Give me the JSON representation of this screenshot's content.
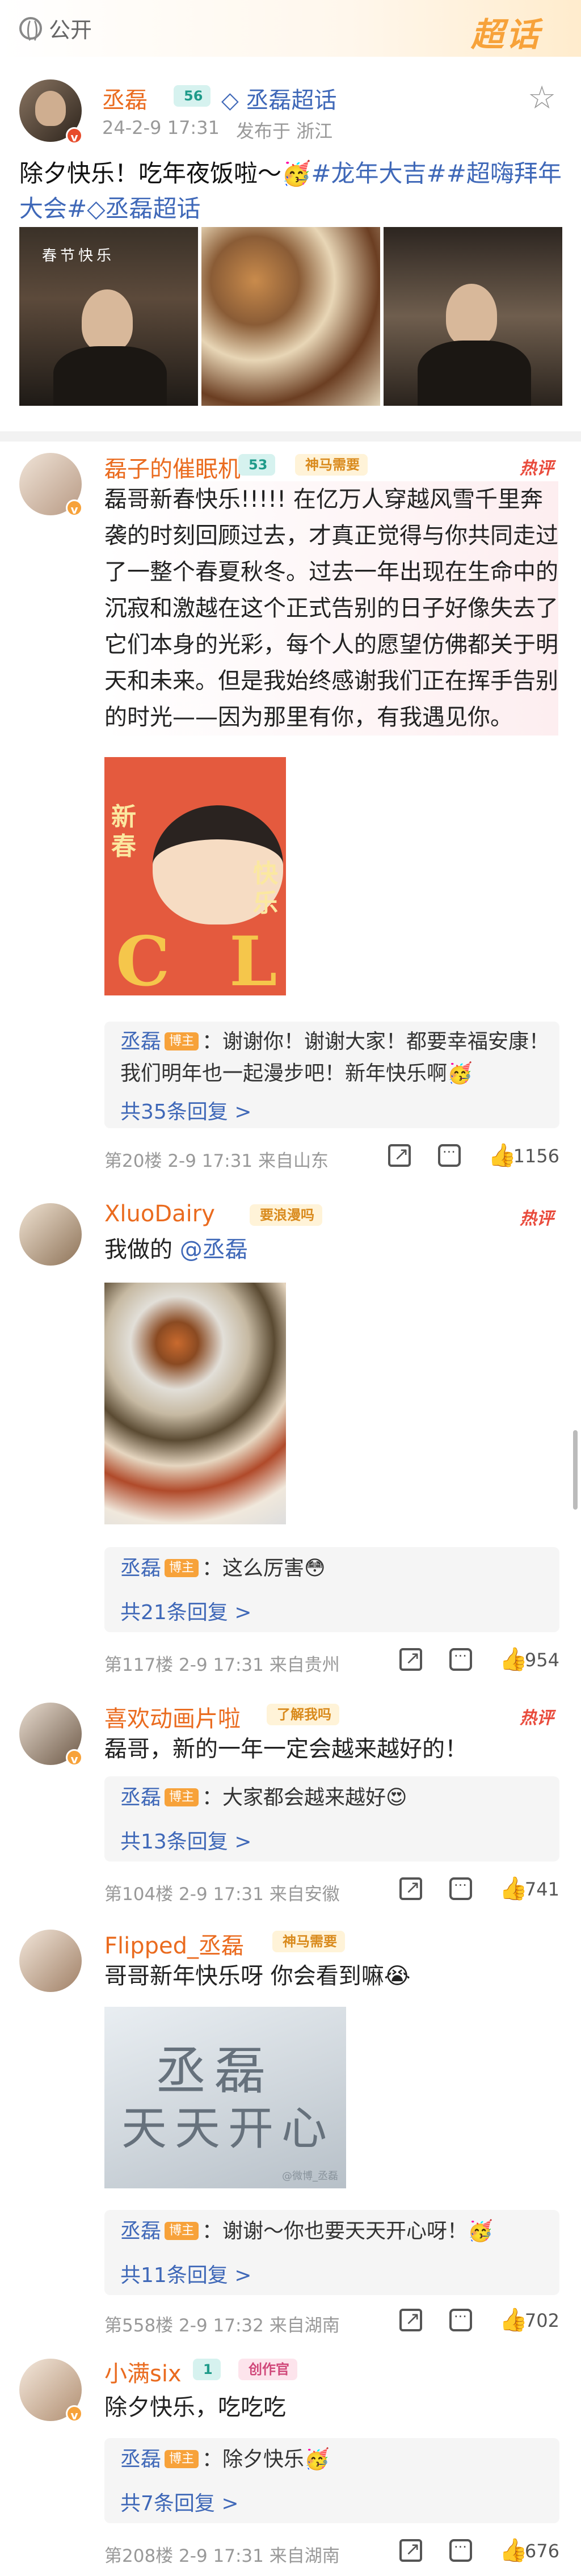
{
  "topbar": {
    "visibility": "公开",
    "logo": "超话"
  },
  "post": {
    "author": "丞磊",
    "level": "56",
    "chaohua": "丞磊超话",
    "time": "24-2-9 17:31",
    "location": "发布于 浙江",
    "text_main": "除夕快乐！吃年夜饭啦～",
    "tag1": "#龙年大吉#",
    "tag2": "#超嗨拜年大会#",
    "tag3": "丞磊超话",
    "photo_caption": "春节快乐"
  },
  "comments": [
    {
      "name": "磊子的催眠机",
      "level": "53",
      "badge": "神马需要",
      "hot": "热评",
      "text": "磊哥新春快乐!!!!! 在亿万人穿越风雪千里奔袭的时刻回顾过去，才真正觉得与你共同走过了一整个春夏秋冬。过去一年出现在生命中的沉寂和激越在这个正式告别的日子好像失去了它们本身的光彩，每个人的愿望仿佛都关于明天和未来。但是我始终感谢我们正在挥手告别的时光——因为那里有你，有我遇见你。",
      "sticker": {
        "char1": "C",
        "char2": "L",
        "side1": "新春",
        "side2": "快乐"
      },
      "reply_name": "丞磊",
      "author_tag": "博主",
      "reply_text": "：谢谢你！谢谢大家！都要幸福安康！我们明年也一起漫步吧！新年快乐啊",
      "reply_count": "共35条回复 >",
      "floor": "第20楼",
      "time": "2-9 17:31",
      "from": "来自山东",
      "likes": "1156"
    },
    {
      "name": "XluoDairy",
      "badge": "要浪漫吗",
      "hot": "热评",
      "text_prefix": "我做的 ",
      "mention": "@丞磊",
      "reply_name": "丞磊",
      "author_tag": "博主",
      "reply_text": "：这么厉害",
      "reply_count": "共21条回复 >",
      "floor": "第117楼",
      "time": "2-9 17:31",
      "from": "来自贵州",
      "likes": "954"
    },
    {
      "name": "喜欢动画片啦",
      "badge": "了解我吗",
      "hot": "热评",
      "text": "磊哥，新的一年一定会越来越好的！",
      "reply_name": "丞磊",
      "author_tag": "博主",
      "reply_text": "：大家都会越来越好",
      "reply_count": "共13条回复 >",
      "floor": "第104楼",
      "time": "2-9 17:31",
      "from": "来自安徽",
      "likes": "741"
    },
    {
      "name": "Flipped_丞磊",
      "badge": "神马需要",
      "text": "哥哥新年快乐呀 你会看到嘛",
      "snow_text1": "丞磊",
      "snow_text2": "天天开心",
      "watermark": "@微博_丞磊",
      "reply_name": "丞磊",
      "author_tag": "博主",
      "reply_text": "：谢谢～你也要天天开心呀！",
      "reply_count": "共11条回复 >",
      "floor": "第558楼",
      "time": "2-9 17:32",
      "from": "来自湖南",
      "likes": "702"
    },
    {
      "name": "小满six",
      "level": "1",
      "badge": "创作官",
      "text": "除夕快乐，吃吃吃",
      "reply_name": "丞磊",
      "author_tag": "博主",
      "reply_text": "：除夕快乐",
      "reply_count": "共7条回复 >",
      "floor": "第208楼",
      "time": "2-9 17:31",
      "from": "来自湖南",
      "likes": "676"
    }
  ]
}
